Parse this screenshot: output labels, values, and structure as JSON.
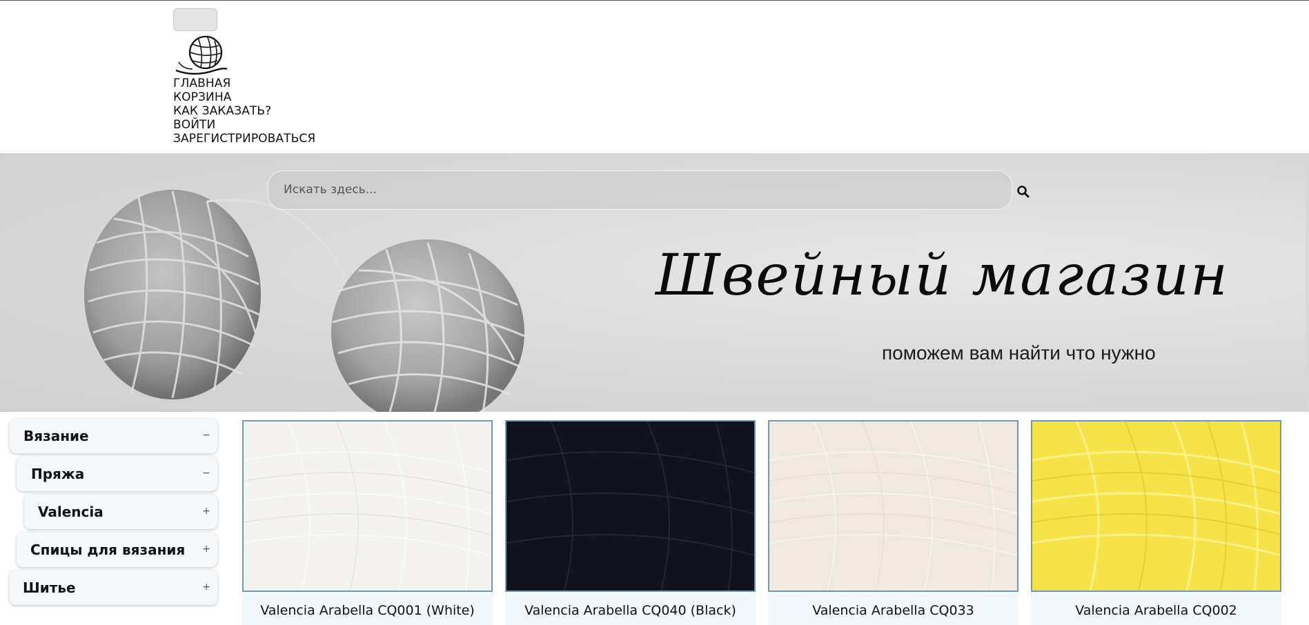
{
  "nav": {
    "items": [
      "ГЛАВНАЯ",
      "КОРЗИНА",
      "КАК ЗАКАЗАТЬ?",
      "ВОЙТИ",
      "ЗАРЕГИСТРИРОВАТЬСЯ"
    ]
  },
  "search": {
    "placeholder": "Искать здесь..."
  },
  "hero": {
    "title": "Швейный магазин",
    "subtitle": "поможем вам найти что нужно"
  },
  "sidebar": {
    "items": [
      {
        "label": "Вязание",
        "sign": "−"
      },
      {
        "label": "Пряжа",
        "sign": "−"
      },
      {
        "label": "Valencia",
        "sign": "+"
      },
      {
        "label": "Спицы для вязания",
        "sign": "+"
      },
      {
        "label": "Шитье",
        "sign": "+"
      }
    ]
  },
  "products": [
    {
      "name": "Valencia Arabella CQ001 (White)",
      "color": "#f4f3f0"
    },
    {
      "name": "Valencia Arabella CQ040 (Black)",
      "color": "#12131f"
    },
    {
      "name": "Valencia Arabella CQ033",
      "color": "#f1e8e0"
    },
    {
      "name": "Valencia Arabella CQ002",
      "color": "#f8e24a"
    }
  ]
}
